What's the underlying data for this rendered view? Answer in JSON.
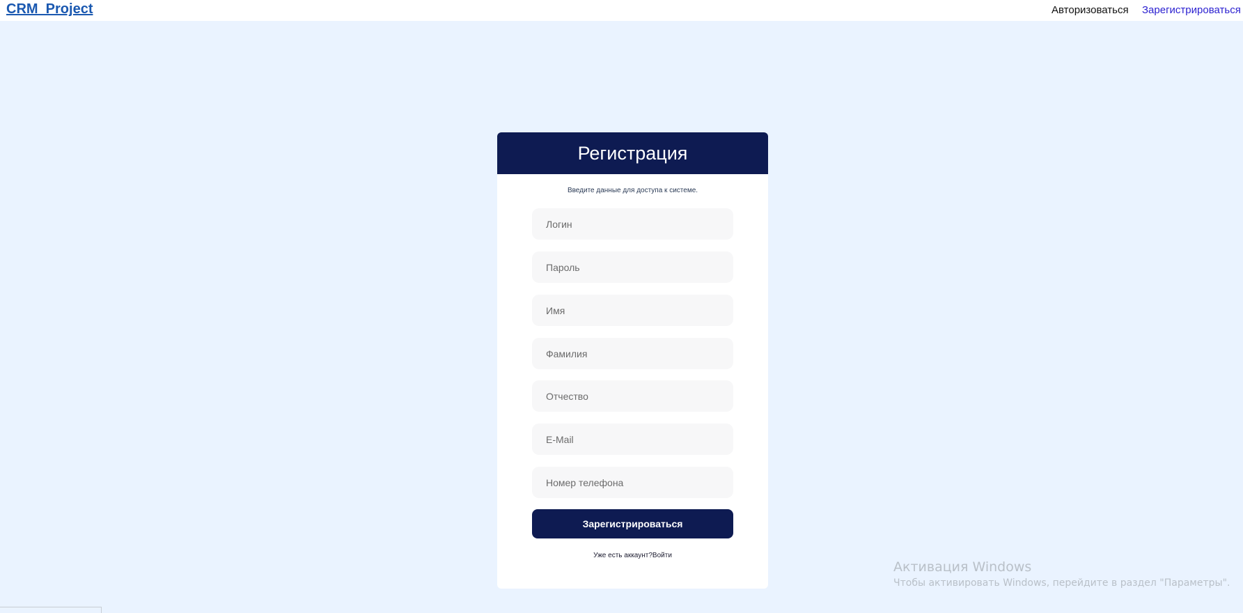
{
  "header": {
    "brand": "CRM_Project",
    "nav": {
      "login": "Авторизоваться",
      "register": "Зарегистрироваться"
    }
  },
  "form": {
    "title": "Регистрация",
    "hint": "Введите данные для доступа к системе.",
    "fields": {
      "login": {
        "placeholder": "Логин",
        "value": ""
      },
      "password": {
        "placeholder": "Пароль",
        "value": ""
      },
      "first_name": {
        "placeholder": "Имя",
        "value": ""
      },
      "last_name": {
        "placeholder": "Фамилия",
        "value": ""
      },
      "patronymic": {
        "placeholder": "Отчество",
        "value": ""
      },
      "email": {
        "placeholder": "E-Mail",
        "value": ""
      },
      "phone": {
        "placeholder": "Номер телефона",
        "value": ""
      }
    },
    "submit_label": "Зарегистрироваться",
    "account_prompt": "Уже есть аккаунт?",
    "login_link": "Войти"
  },
  "watermark": {
    "title": "Активация Windows",
    "subtitle": "Чтобы активировать Windows, перейдите в раздел \"Параметры\"."
  },
  "colors": {
    "background": "#eaf3ff",
    "header_navy": "#0e1b52",
    "brand_link": "#1a58b0",
    "register_link": "#2a1fd0"
  }
}
